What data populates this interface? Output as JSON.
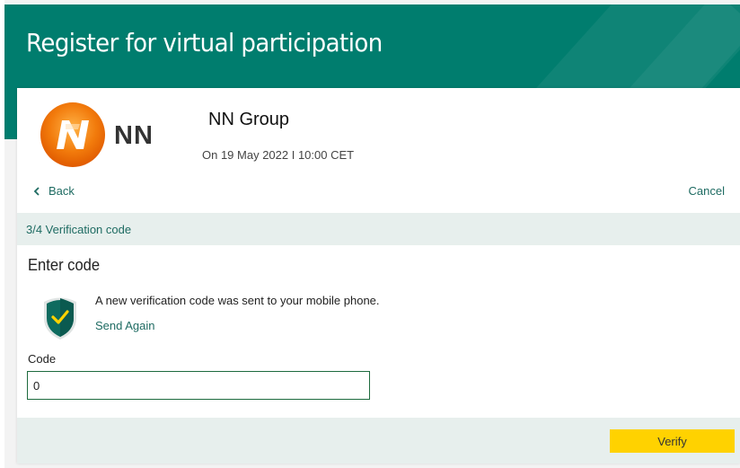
{
  "header": {
    "title": "Register for virtual participation"
  },
  "event": {
    "logo_text": "NN",
    "company_name": "NN Group",
    "date": "On 19 May 2022 I 10:00 CET"
  },
  "nav": {
    "back_label": "Back",
    "cancel_label": "Cancel"
  },
  "step": {
    "label": "3/4 Verification code"
  },
  "form": {
    "title": "Enter code",
    "message": "A new verification code was sent to your mobile phone.",
    "send_again_label": "Send Again",
    "code_label": "Code",
    "code_value": "0"
  },
  "actions": {
    "verify_label": "Verify"
  },
  "colors": {
    "header_bg": "#007d6e",
    "link": "#1e6b62",
    "step_bg": "#e7efed",
    "verify_bg": "#ffd200",
    "logo_orange": "#f27b0c"
  },
  "icons": {
    "logo": "nn-lion-logo-icon",
    "shield": "shield-check-icon",
    "back": "chevron-left-icon"
  }
}
